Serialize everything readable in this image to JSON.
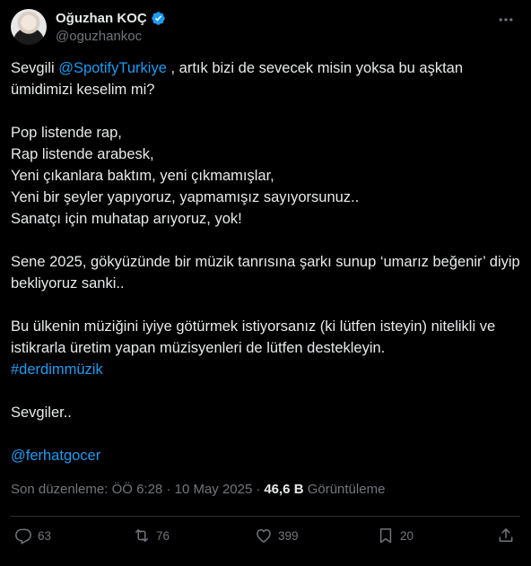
{
  "author": {
    "display_name": "Oğuzhan KOÇ",
    "handle": "@oguzhankoc"
  },
  "tweet": {
    "p1": {
      "pre": "Sevgili ",
      "mention": "@SpotifyTurkiye",
      "post": " , artık bizi de sevecek misin yoksa bu aşktan ümidimizi keselim mi?"
    },
    "p2_lines": [
      "Pop listende rap,",
      "Rap listende arabesk,",
      "Yeni çıkanlara baktım, yeni çıkmamışlar,",
      "Yeni bir şeyler yapıyoruz, yapmamışız sayıyorsunuz..",
      "Sanatçı için muhatap arıyoruz, yok!"
    ],
    "p3": "Sene 2025, gökyüzünde bir müzik tanrısına şarkı sunup ‘umarız beğenir’ diyip bekliyoruz sanki..",
    "p4": "Bu ülkenin müziğini iyiye götürmek istiyorsanız (ki lütfen isteyin) nitelikli ve istikrarla üretim yapan müzisyenleri de lütfen destekleyin.",
    "hashtag": "#derdimmüzik",
    "p5": "Sevgiler..",
    "mention2": "@ferhatgocer"
  },
  "meta": {
    "edited_label": "Son düzenleme: ÖÖ 6:28 · 10 May 2025",
    "sep": "·",
    "views_count": "46,6 B",
    "views_label": "Görüntüleme"
  },
  "actions": {
    "replies": "63",
    "retweets": "76",
    "likes": "399",
    "bookmarks": "20"
  },
  "colors": {
    "background": "#000000",
    "text": "#e7e9ea",
    "muted": "#71767b",
    "accent": "#1d9bf0",
    "divider": "#2f3336"
  },
  "icons": [
    "verified-badge-icon",
    "more-icon",
    "reply-icon",
    "retweet-icon",
    "like-icon",
    "bookmark-icon",
    "share-icon"
  ]
}
